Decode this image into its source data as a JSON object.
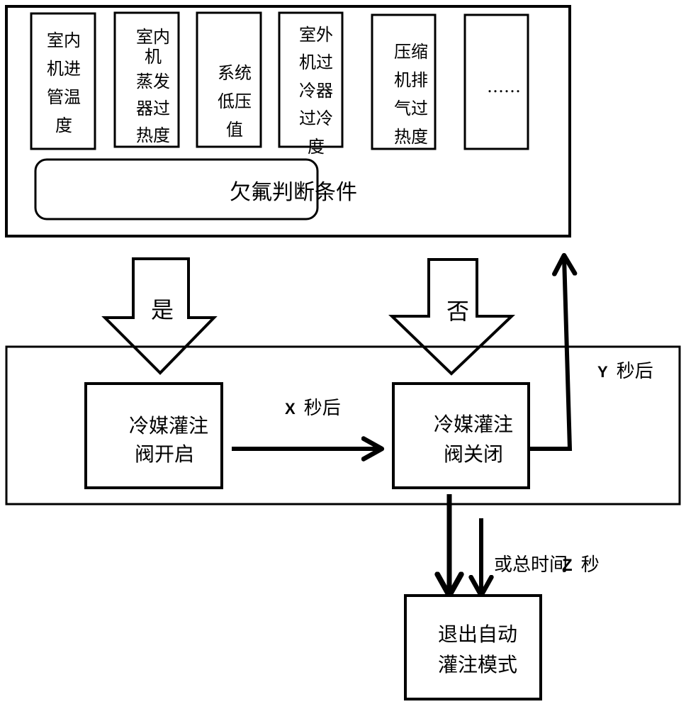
{
  "condition_panel": {
    "factors": [
      {
        "lines": [
          "室内",
          "机进",
          "管温",
          "度"
        ]
      },
      {
        "lines": [
          "室内",
          "机",
          "蒸发",
          "器过",
          "热度"
        ]
      },
      {
        "lines": [
          "系统",
          "低压",
          "值"
        ]
      },
      {
        "lines": [
          "室外",
          "机过",
          "冷器",
          "过冷",
          "度"
        ]
      },
      {
        "lines": [
          "压缩",
          "机排",
          "气过",
          "热度"
        ]
      },
      {
        "lines": [
          "……"
        ]
      }
    ],
    "judgment_label": "欠氟判断条件"
  },
  "yes_arrow": {
    "label": "是"
  },
  "no_arrow": {
    "label": "否"
  },
  "process_panel": {
    "valve_open": {
      "lines": [
        "冷媒灌注",
        "阀开启"
      ]
    },
    "valve_close": {
      "lines": [
        "冷媒灌注",
        "阀关闭"
      ]
    },
    "x_delay": {
      "var": "X",
      "text": "秒后"
    },
    "y_delay": {
      "var": "Y",
      "text": "秒后"
    }
  },
  "exit": {
    "total_time_prefix": "或总时间",
    "total_time_var": "Z",
    "total_time_suffix": "秒",
    "lines": [
      "退出自动",
      "灌注模式"
    ]
  }
}
